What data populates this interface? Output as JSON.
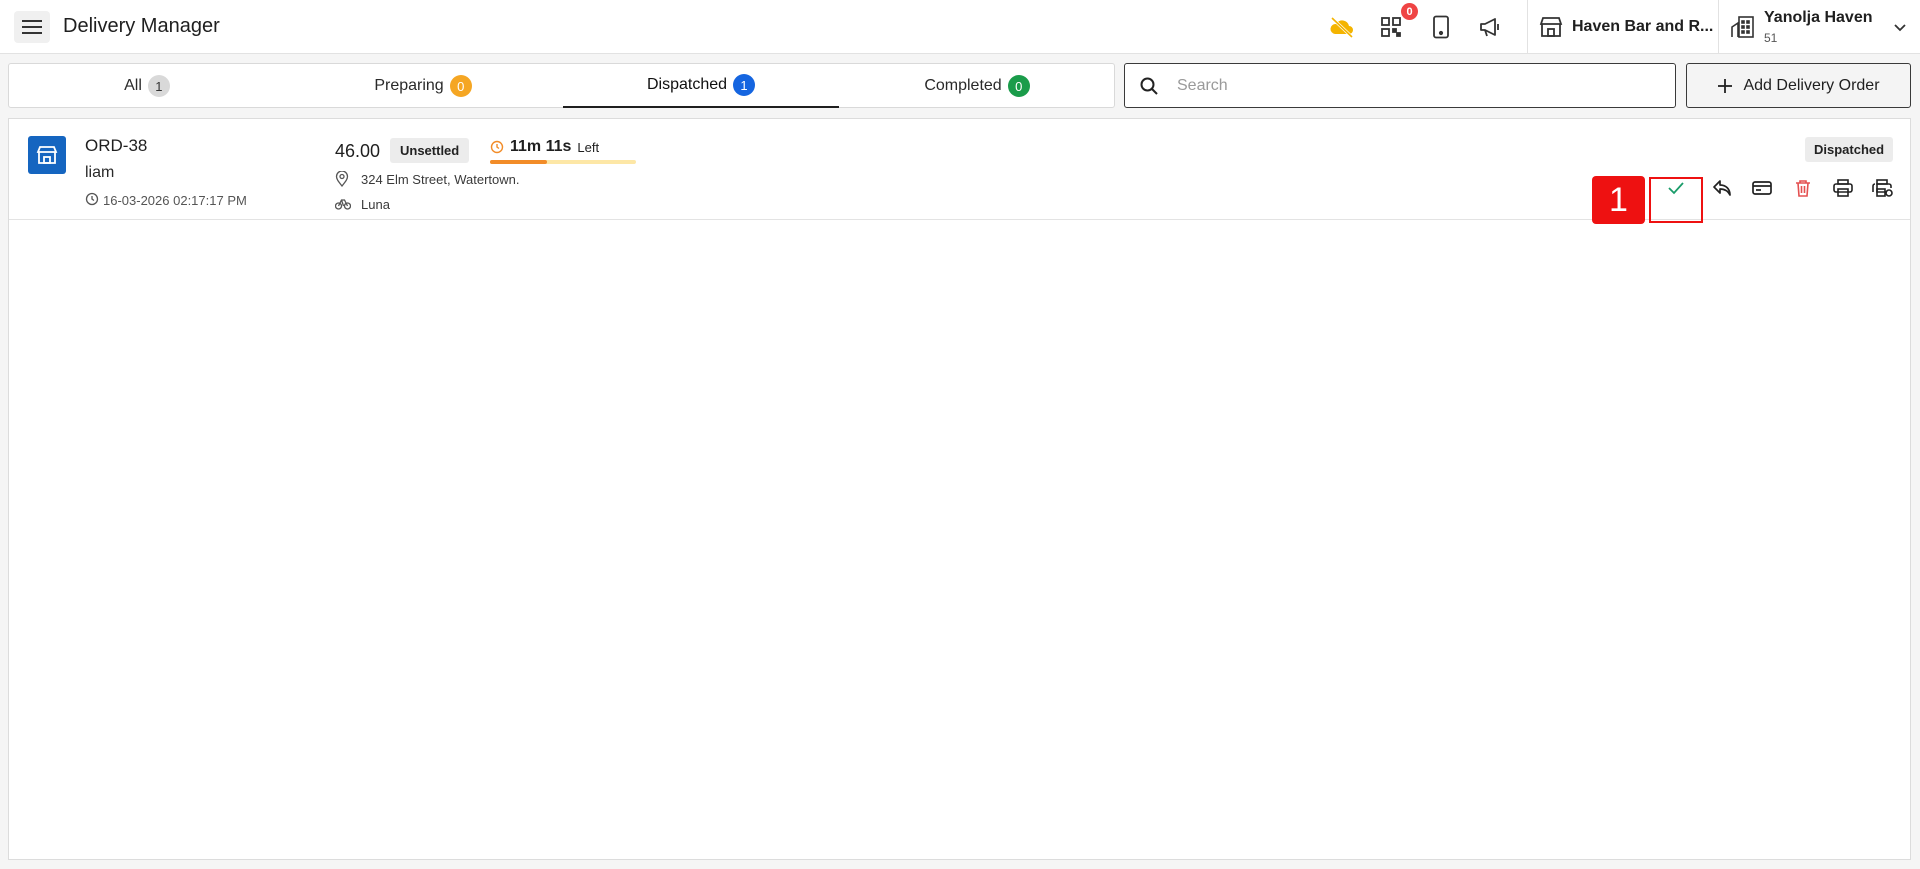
{
  "header": {
    "title": "Delivery Manager",
    "notification_count": "0",
    "store_name": "Haven Bar and R...",
    "user_name": "Yanolja Haven",
    "user_sub": "51"
  },
  "tabs": [
    {
      "label": "All",
      "count": "1"
    },
    {
      "label": "Preparing",
      "count": "0"
    },
    {
      "label": "Dispatched",
      "count": "1"
    },
    {
      "label": "Completed",
      "count": "0"
    }
  ],
  "search": {
    "placeholder": "Search"
  },
  "add_button": {
    "label": "Add Delivery Order"
  },
  "order": {
    "id": "ORD-38",
    "customer": "liam",
    "datetime": "16-03-2026 02:17:17 PM",
    "amount": "46.00",
    "payment_status": "Unsettled",
    "timer": "11m 11s",
    "timer_suffix": "Left",
    "time_progress": 0.39,
    "address": "324 Elm Street, Watertown.",
    "rider": "Luna",
    "status": "Dispatched"
  },
  "annotation": {
    "step": "1"
  },
  "colors": {
    "brand_blue": "#1565c0",
    "badge_gray": "#d9d9d9",
    "badge_orange": "#f5a623",
    "badge_blue": "#1565e0",
    "badge_green": "#1a9c4a",
    "delete_red": "#e45050",
    "check_green": "#1a9c6a",
    "marker_red": "#ee1111"
  }
}
